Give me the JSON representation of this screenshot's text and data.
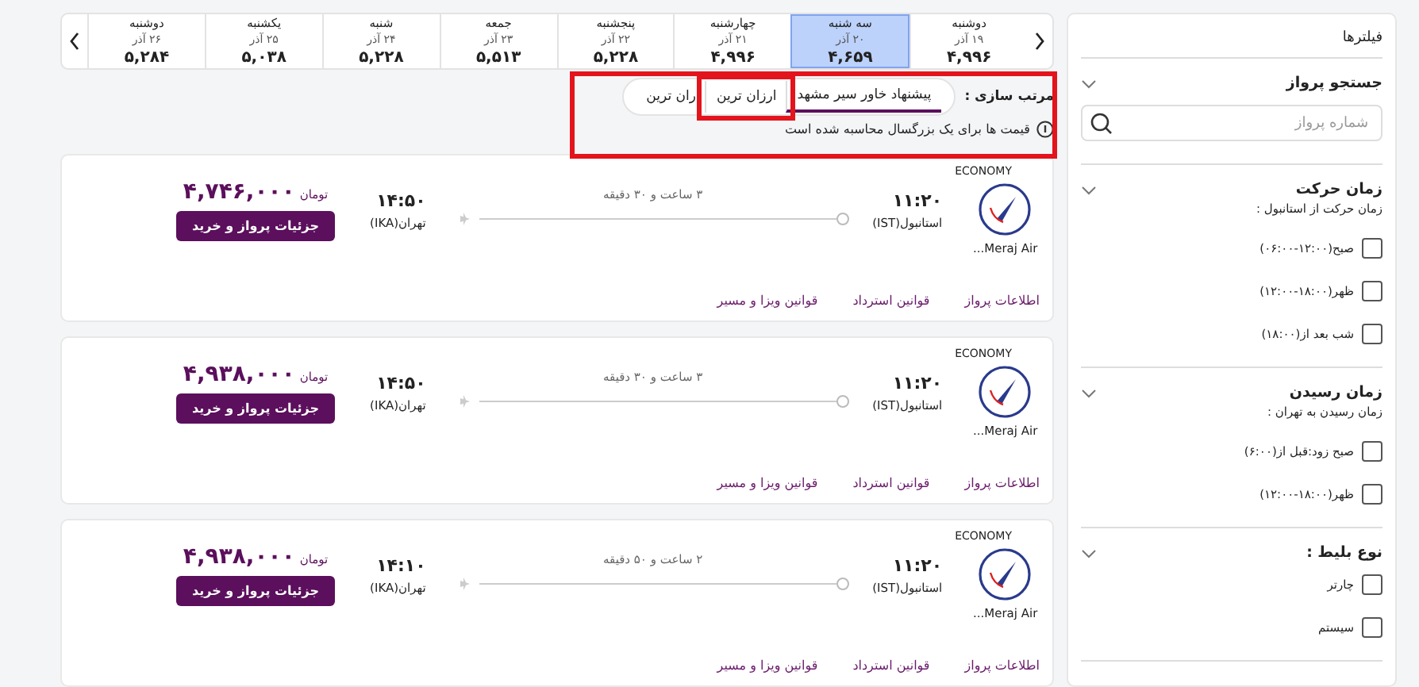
{
  "filters": {
    "title": "فیلترها",
    "sections": [
      {
        "kind": "search",
        "title": "جستجو پرواز",
        "placeholder": "شماره پرواز",
        "expanded": true
      },
      {
        "kind": "checks",
        "title": "زمان حرکت",
        "subtitle": "زمان حرکت از استانبول :",
        "expanded": true,
        "options": [
          {
            "label": "صبح(۱۲:۰۰-۰۶:۰۰)",
            "checked": false
          },
          {
            "label": "ظهر(۱۸:۰۰-۱۲:۰۰)",
            "checked": false
          },
          {
            "label": "شب بعد از(۱۸:۰۰)",
            "checked": false
          }
        ]
      },
      {
        "kind": "checks",
        "title": "زمان رسیدن",
        "subtitle": "زمان رسیدن به تهران :",
        "expanded": true,
        "options": [
          {
            "label": "صبح زود:قبل از(۶:۰۰)",
            "checked": false
          },
          {
            "label": "ظهر(۱۸:۰۰-۱۲:۰۰)",
            "checked": false
          }
        ]
      },
      {
        "kind": "checks",
        "title": "نوع بلیط :",
        "expanded": true,
        "options": [
          {
            "label": "چارتر",
            "checked": false
          },
          {
            "label": "سیستم",
            "checked": false
          }
        ]
      }
    ]
  },
  "days": [
    {
      "weekday": "دوشنبه",
      "date": "۱۹ آذر",
      "price": "۴,۹۹۶",
      "selected": false
    },
    {
      "weekday": "سه شنبه",
      "date": "۲۰ آذر",
      "price": "۴,۶۵۹",
      "selected": true
    },
    {
      "weekday": "چهارشنبه",
      "date": "۲۱ آذر",
      "price": "۴,۹۹۶",
      "selected": false
    },
    {
      "weekday": "پنجشنبه",
      "date": "۲۲ آذر",
      "price": "۵,۲۲۸",
      "selected": false
    },
    {
      "weekday": "جمعه",
      "date": "۲۳ آذر",
      "price": "۵,۵۱۳",
      "selected": false
    },
    {
      "weekday": "شنبه",
      "date": "۲۴ آذر",
      "price": "۵,۲۲۸",
      "selected": false
    },
    {
      "weekday": "یکشنبه",
      "date": "۲۵ آذر",
      "price": "۵,۰۳۸",
      "selected": false
    },
    {
      "weekday": "دوشنبه",
      "date": "۲۶ آذر",
      "price": "۵,۲۸۴",
      "selected": false
    }
  ],
  "sort": {
    "label": "مرتب سازی :",
    "options": [
      {
        "label": "پیشنهاد خاور سیر مشهد",
        "selected": true
      },
      {
        "label": "ارزان ترین",
        "selected": false
      },
      {
        "label": "ران ترین",
        "selected": false
      }
    ]
  },
  "note": "قیمت ها برای یک بزرگسال محاسبه شده است",
  "flights": [
    {
      "cabin": "ECONOMY",
      "airline": "Meraj Air...",
      "dep_time": "۱۱:۲۰",
      "dep_place": "استانبول(IST)",
      "duration": "۳ ساعت و ۳۰ دقیقه",
      "arr_time": "۱۴:۵۰",
      "arr_place": "تهران(IKA)",
      "price": "۴,۷۴۶,۰۰۰",
      "currency": "تومان",
      "button": "جزئیات پرواز و خرید",
      "links": [
        "اطلاعات پرواز",
        "قوانین استرداد",
        "قوانین ویزا و مسیر"
      ]
    },
    {
      "cabin": "ECONOMY",
      "airline": "Meraj Air...",
      "dep_time": "۱۱:۲۰",
      "dep_place": "استانبول(IST)",
      "duration": "۳ ساعت و ۳۰ دقیقه",
      "arr_time": "۱۴:۵۰",
      "arr_place": "تهران(IKA)",
      "price": "۴,۹۳۸,۰۰۰",
      "currency": "تومان",
      "button": "جزئیات پرواز و خرید",
      "links": [
        "اطلاعات پرواز",
        "قوانین استرداد",
        "قوانین ویزا و مسیر"
      ]
    },
    {
      "cabin": "ECONOMY",
      "airline": "Meraj Air...",
      "dep_time": "۱۱:۲۰",
      "dep_place": "استانبول(IST)",
      "duration": "۲ ساعت و ۵۰ دقیقه",
      "arr_time": "۱۴:۱۰",
      "arr_place": "تهران(IKA)",
      "price": "۴,۹۳۸,۰۰۰",
      "currency": "تومان",
      "button": "جزئیات پرواز و خرید",
      "links": [
        "اطلاعات پرواز",
        "قوانین استرداد",
        "قوانین ویزا و مسیر"
      ]
    }
  ],
  "highlights": {
    "sort_area": true,
    "cheapest_tab": true
  }
}
